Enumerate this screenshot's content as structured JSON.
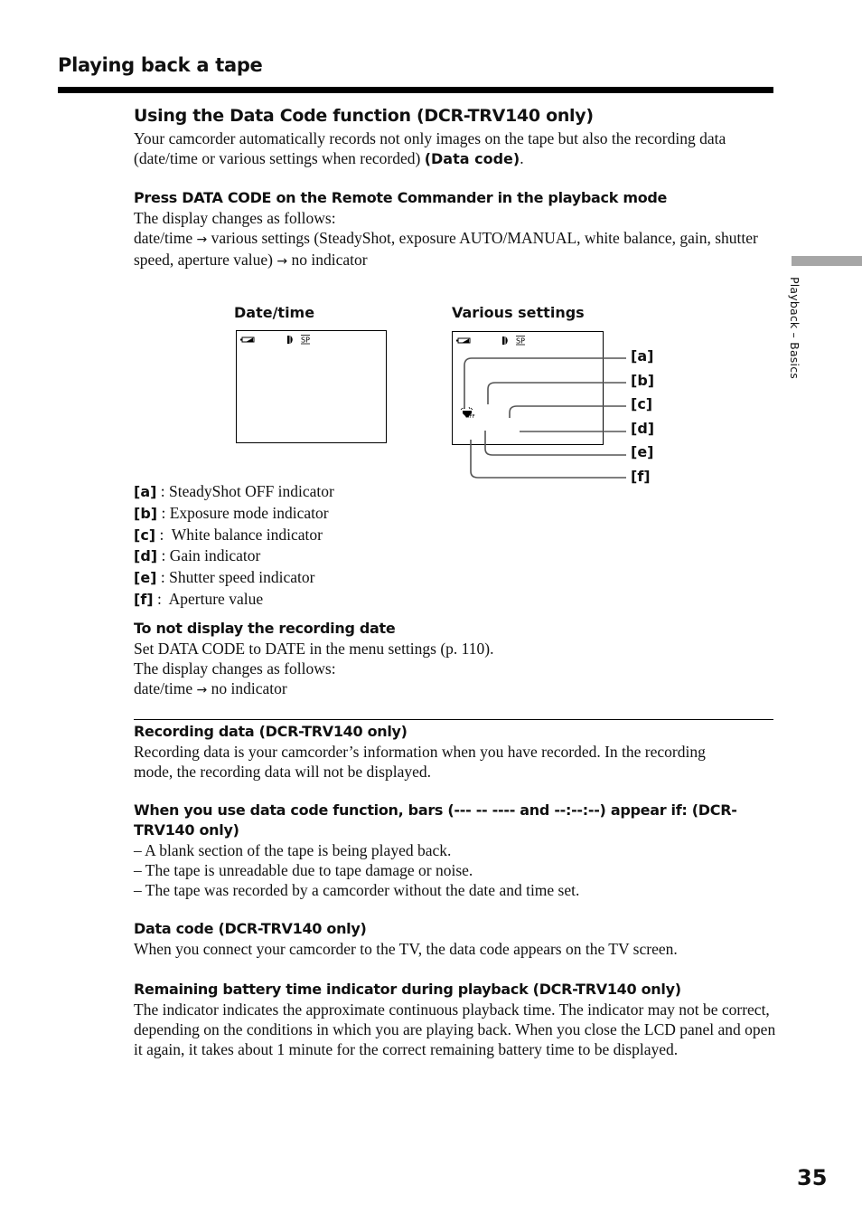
{
  "chapter": {
    "title": "Playing back a tape"
  },
  "section": {
    "title": "Using the Data Code function (DCR-TRV140 only)",
    "intro_text": "Your camcorder automatically records not only images on the tape but also the recording data (date/time or various settings when recorded) ",
    "intro_bold": "(Data code)",
    "intro_end": "."
  },
  "press": {
    "heading": "Press DATA CODE on the Remote Commander in the playback mode",
    "line1": "The display changes as follows:",
    "seq_part1": "date/time ",
    "arrow": "→",
    "seq_part2": " various settings (SteadyShot, exposure AUTO/MANUAL, white balance, gain, shutter speed, aperture value) ",
    "seq_part3": " no indicator"
  },
  "diagram": {
    "date_label": "Date/time",
    "various_label": "Various settings",
    "screen_icons": {
      "battery": "battery-icon",
      "tape": "tape-icon",
      "sp": "SP"
    },
    "steadyshot_icon_text": "OFF",
    "callouts": [
      "[a]",
      "[b]",
      "[c]",
      "[d]",
      "[e]",
      "[f]"
    ]
  },
  "legend": [
    {
      "key": "[a]",
      "sep": " : ",
      "text": "SteadyShot OFF indicator"
    },
    {
      "key": "[b]",
      "sep": " : ",
      "text": "Exposure mode indicator"
    },
    {
      "key": "[c]",
      "sep": " :  ",
      "text": "White balance indicator"
    },
    {
      "key": "[d]",
      "sep": " : ",
      "text": "Gain indicator"
    },
    {
      "key": "[e]",
      "sep": " : ",
      "text": "Shutter speed indicator"
    },
    {
      "key": "[f]",
      "sep": " :  ",
      "text": "Aperture value"
    }
  ],
  "no_display": {
    "heading": "To not display the recording date",
    "line1": "Set DATA CODE to DATE in the menu settings (p. 110).",
    "line2": "The display changes as follows:",
    "seq_part1": "date/time ",
    "arrow": "→",
    "seq_part2": " no indicator"
  },
  "recording_data": {
    "heading": "Recording data (DCR-TRV140 only)",
    "text": "Recording data is your camcorder’s information when you have recorded. In the recording mode, the recording data will not be displayed."
  },
  "bars": {
    "heading": "When you use data code function, bars (--- -- ---- and --:--:--) appear if: (DCR-TRV140 only)",
    "items": [
      "– A blank section of the tape is being played back.",
      "– The tape is unreadable due to tape damage or noise.",
      "– The tape was recorded by a camcorder without the date and time set."
    ]
  },
  "data_code": {
    "heading": "Data code (DCR-TRV140 only)",
    "text": "When you connect your camcorder to the TV, the data code appears on the TV screen."
  },
  "battery": {
    "heading": "Remaining battery time indicator during playback (DCR-TRV140 only)",
    "text": "The indicator indicates the approximate continuous playback time. The indicator may not be correct, depending on the conditions in which you are playing back. When you close the LCD panel and open it again, it takes about 1 minute for the correct remaining battery time to be displayed."
  },
  "side_tab": {
    "label": "Playback – Basics"
  },
  "page_number": "35"
}
